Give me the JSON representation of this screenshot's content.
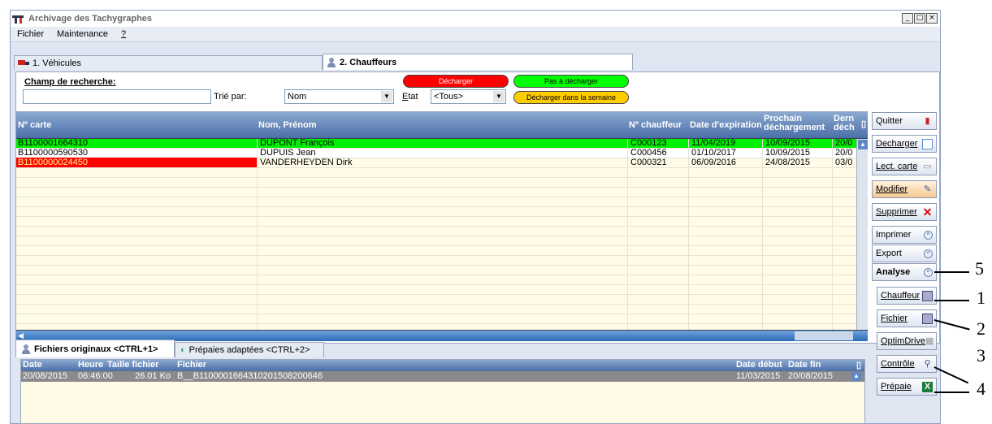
{
  "window": {
    "title": "Archivage des Tachygraphes",
    "controls": [
      "_",
      "□",
      "×"
    ]
  },
  "menu": [
    "Fichier",
    "Maintenance",
    "?"
  ],
  "tabs": [
    {
      "label": "1. Véhicules",
      "icon": "truck-icon"
    },
    {
      "label": "2. Chauffeurs",
      "icon": "person-icon"
    }
  ],
  "search": {
    "label": "Champ de recherche:",
    "value": "",
    "sort_label": "Trié par:",
    "sort_value": "Nom",
    "etat_label": "Etat",
    "etat_value": "<Tous>"
  },
  "legend": {
    "red": "Décharger",
    "green": "Pas à décharger",
    "yellow": "Décharger dans la semaine"
  },
  "grid": {
    "columns": [
      "Nº carte",
      "Nom, Prénom",
      "Nº chauffeur",
      "Date d'expiration",
      "Prochain déchargement",
      "Dern déch"
    ],
    "rows": [
      {
        "status": "green",
        "carte": "B1100001664310",
        "nom": "DUPONT François",
        "chauffeur": "C000123",
        "expiration": "11/04/2019",
        "prochain": "10/09/2015",
        "dernier": "20/0"
      },
      {
        "status": "white",
        "carte": "B1100000590530",
        "nom": "DUPUIS Jean",
        "chauffeur": "C000456",
        "expiration": "01/10/2017",
        "prochain": "10/09/2015",
        "dernier": "20/0"
      },
      {
        "status": "red",
        "carte": "B1100000024450",
        "nom": "VANDERHEYDEN Dirk",
        "chauffeur": "C000321",
        "expiration": "06/09/2016",
        "prochain": "24/08/2015",
        "dernier": "03/0"
      }
    ]
  },
  "side_buttons": {
    "quitter": "Quitter",
    "decharger": "Decharger",
    "lect_carte": "Lect. carte",
    "modifier": "Modifier",
    "supprimer": "Supprimer",
    "imprimer": "Imprimer",
    "export": "Export",
    "analyse": "Analyse",
    "chauffeur": "Chauffeur",
    "fichier": "Fichier",
    "optimdrive": "OptimDrive",
    "controle": "Contrôle",
    "prepaie": "Prépaie"
  },
  "bottom_tabs": [
    "Fichiers originaux <CTRL+1>",
    "Prépaies adaptées <CTRL+2>"
  ],
  "files": {
    "columns": [
      "Date",
      "Heure",
      "Taille fichier",
      "Fichier",
      "Date début",
      "Date fin"
    ],
    "rows": [
      {
        "date": "20/08/2015",
        "heure": "06:46:00",
        "taille": "26.01 Ko",
        "fichier": "B__B1100001664310201508200646",
        "debut": "11/03/2015",
        "fin": "20/08/2015"
      }
    ]
  },
  "annotations": [
    "5",
    "1",
    "2",
    "3",
    "4"
  ]
}
